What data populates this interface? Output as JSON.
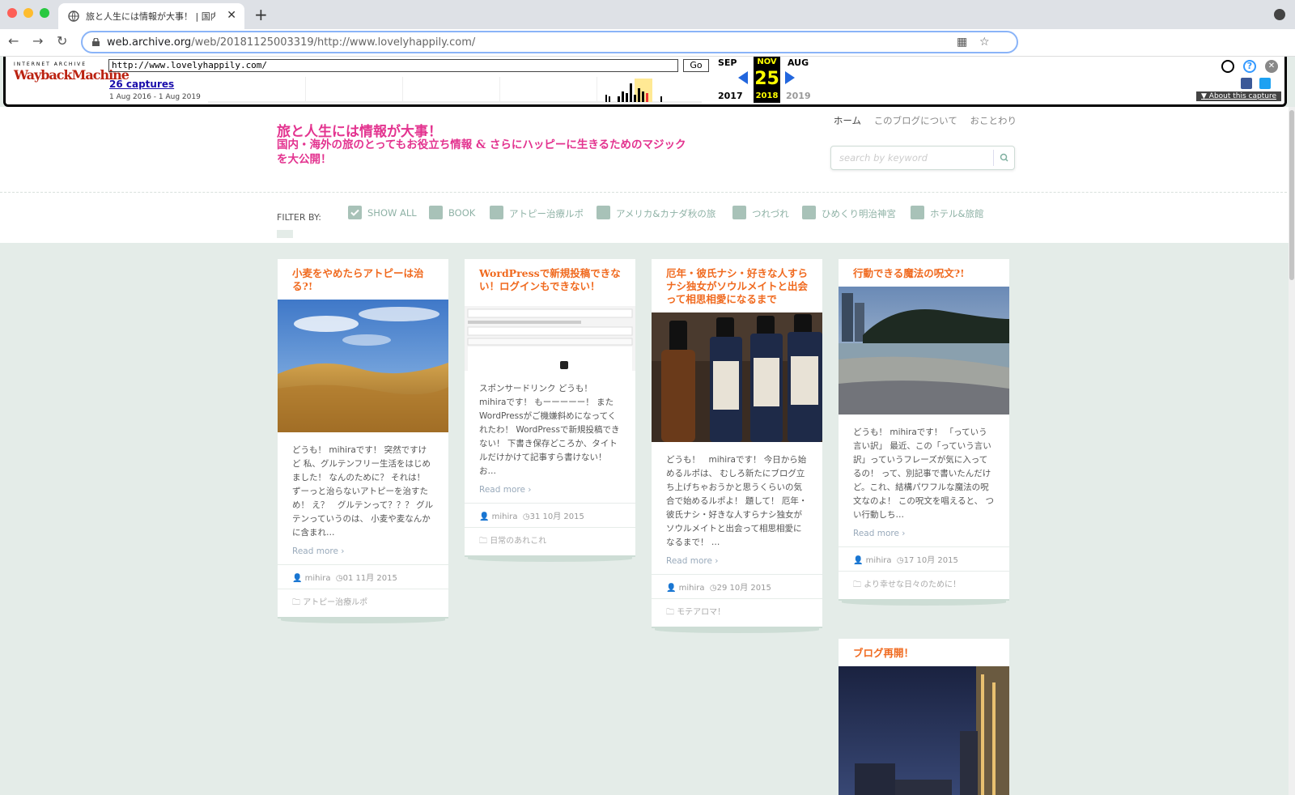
{
  "browser": {
    "tab_title": "旅と人生には情報が大事！ | 国内・",
    "url_host": "web.archive.org",
    "url_path": "/web/20181125003319/http://www.lovelyhappily.com/"
  },
  "wayback": {
    "logo_top": "INTERNET ARCHIVE",
    "logo_main": "WaybackMachine",
    "url_input": "http://www.lovelyhappily.com/",
    "go_label": "Go",
    "captures": "26 captures",
    "range": "1 Aug 2016 - 1 Aug 2019",
    "prev_month": "SEP",
    "cur_month": "NOV",
    "next_month": "AUG",
    "prev_year": "2017",
    "cur_year": "2018",
    "next_year": "2019",
    "cur_day": "25",
    "about": "About this capture"
  },
  "site": {
    "title": "旅と人生には情報が大事！",
    "description": "国内・海外の旅のとってもお役立ち情報 & さらにハッピーに生きるためのマジックを大公開！",
    "nav": [
      "ホーム",
      "このブログについて",
      "おことわり"
    ],
    "search_placeholder": "search by keyword"
  },
  "filters": {
    "label": "FILTER BY:",
    "items": [
      "SHOW ALL",
      "BOOK",
      "アトピー治療ルポ",
      "アメリカ&カナダ秋の旅",
      "つれづれ",
      "ひめくり明治神宮",
      "ホテル&旅館"
    ]
  },
  "posts": [
    {
      "title": "小麦をやめたらアトピーは治る?!",
      "excerpt": "どうも！ mihiraです！ 突然ですけど 私、グルテンフリー生活をはじめました！ なんのために？ それは！ ずーっと治らないアトピーを治すため！ え？　グルテンって？？？ グルテンっていうのは、 小麦や麦なんかに含まれ…",
      "more": "Read more ›",
      "author": "mihira",
      "date": "01 11月 2015",
      "category": "アトピー治療ルポ"
    },
    {
      "title": "WordPressで新規投稿できない！ログインもできない！",
      "excerpt": "スポンサードリンク どうも！ mihiraです！ もーーーーー！ またWordPressがご機嫌斜めになってくれたわ！ WordPressで新規投稿できない！ 下書き保存どころか、タイトルだけかけて記事すら書けない！ お…",
      "more": "Read more ›",
      "author": "mihira",
      "date": "31 10月 2015",
      "category": "日常のあれこれ"
    },
    {
      "title": "厄年・彼氏ナシ・好きな人すらナシ独女がソウルメイトと出会って相思相愛になるまで",
      "excerpt": "どうも！　mihiraです！ 今日から始めるルポは、 むしろ新たにブログ立ち上げちゃおうかと思うくらいの気合で始めるルポよ！ 題して！ 厄年・彼氏ナシ・好きな人すらナシ独女が ソウルメイトと出会って相思相愛になるまで！ …",
      "more": "Read more ›",
      "author": "mihira",
      "date": "29 10月 2015",
      "category": "モテアロマ！"
    },
    {
      "title": "行動できる魔法の呪文?!",
      "excerpt": "どうも！ mihiraです！ 「っていう言い訳」 最近、この「っていう言い訳」っていうフレーズが気に入ってるの！ って、別記事で書いたんだけど。これ、結構パワフルな魔法の呪文なのよ！ この呪文を唱えると、 つい行動しち…",
      "more": "Read more ›",
      "author": "mihira",
      "date": "17 10月 2015",
      "category": "より幸せな日々のために！"
    },
    {
      "title": "ブログ再開！"
    }
  ],
  "colors": {
    "accent_pink": "#e3338f",
    "post_title_orange": "#f06a1f",
    "filter_green": "#a8c2b8",
    "page_bg": "#e4ece8"
  }
}
